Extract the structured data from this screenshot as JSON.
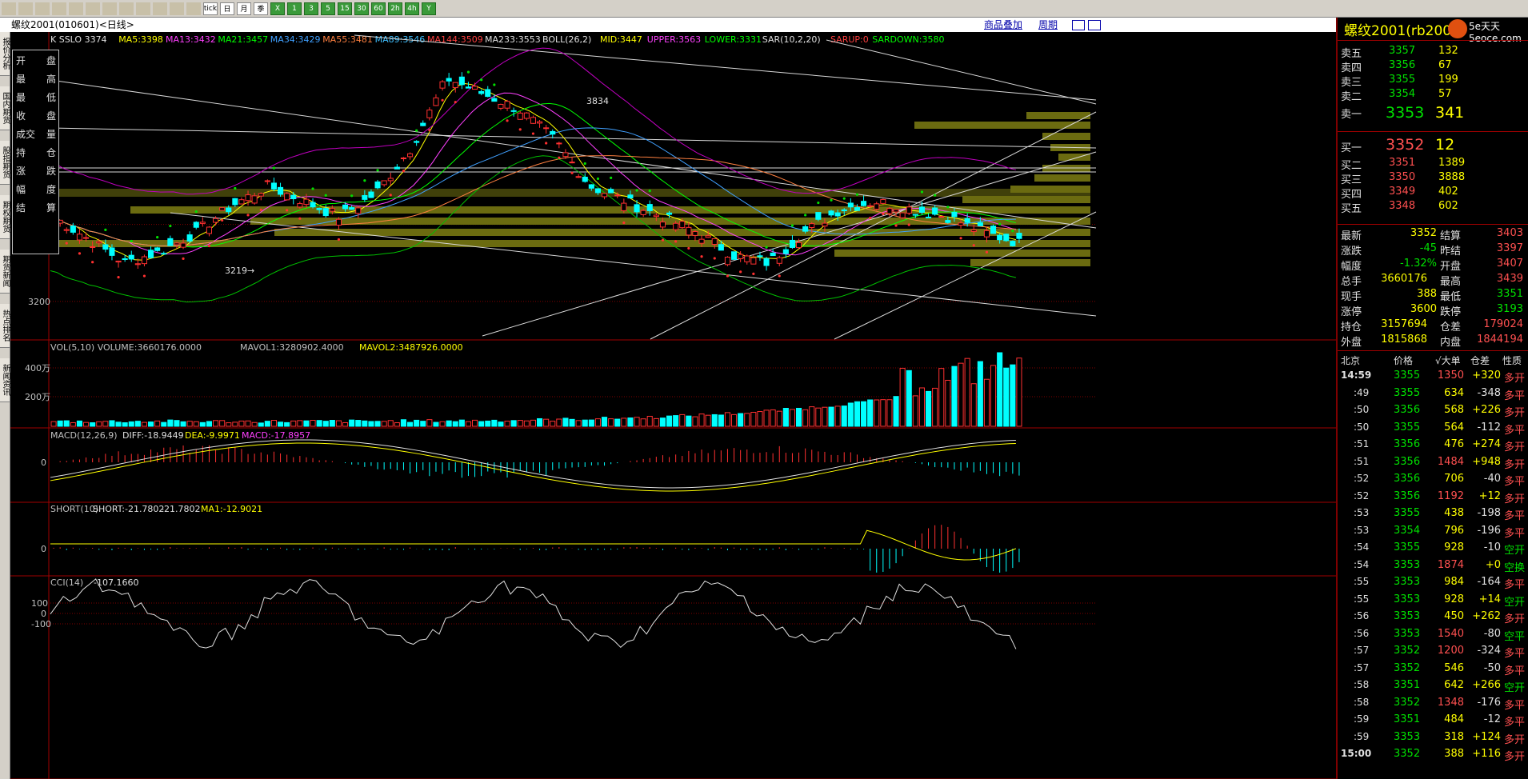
{
  "toolbar": {
    "icons": [
      "arrow-left-icon",
      "home-icon",
      "notebook-icon",
      "box-icon",
      "zoom-in-icon",
      "zoom-out-icon",
      "window-icon",
      "pencil-icon",
      "eraser-icon",
      "funnel-icon",
      "table-icon",
      "line-chart-icon",
      "tick-icon",
      "day-icon",
      "month-icon",
      "week-icon",
      "cross-icon",
      "1-min-icon",
      "3-min-icon",
      "5-min-icon",
      "15-min-icon",
      "30-min-icon",
      "60-min-icon",
      "2h-icon",
      "4h-icon",
      "year-icon"
    ],
    "labels": [
      "",
      "",
      "",
      "",
      "",
      "",
      "",
      "",
      "",
      "",
      "",
      "",
      "tick",
      "日",
      "月",
      "季",
      "X",
      "1",
      "3",
      "5",
      "15",
      "30",
      "60",
      "2h",
      "4h",
      "Y"
    ]
  },
  "titlebar": {
    "title": "螺纹2001(010601)<日线>",
    "link1": "商品叠加",
    "link2": "周期"
  },
  "left_tabs": [
    "报价分析",
    "国内期货",
    "股指期货",
    "期权期货",
    "期货新闻",
    "热点排名",
    "新闻资讯"
  ],
  "indicator_line": {
    "k": "K  SSLO 3374",
    "ma5": "MA5:3398",
    "ma13": "MA13:3432",
    "ma21": "MA21:3457",
    "ma34": "MA34:3429",
    "ma55": "MA55:3481",
    "ma89": "MA89:3546",
    "ma144": "MA144:3509",
    "ma233": "MA233:3553",
    "boll": "BOLL(26,2)",
    "mid": "MID:3447",
    "upper": "UPPER:3563",
    "lower": "LOWER:3331",
    "sar": "SAR(10,2,20)",
    "sarup": "SARUP:0",
    "sardown": "SARDOWN:3580"
  },
  "infobox": [
    {
      "a": "开",
      "b": "盘"
    },
    {
      "a": "最",
      "b": "高"
    },
    {
      "a": "最",
      "b": "低"
    },
    {
      "a": "收",
      "b": "盘"
    },
    {
      "a": "成交",
      "b": "量"
    },
    {
      "a": "持",
      "b": "仓"
    },
    {
      "a": "涨",
      "b": "跌"
    },
    {
      "a": "幅",
      "b": "度"
    },
    {
      "a": "结",
      "b": "算"
    }
  ],
  "price_axis": [
    "3400",
    "3200"
  ],
  "annotations": {
    "high": "3834",
    "low": "3219"
  },
  "vol": {
    "line1": "VOL(5,10) VOLUME:3660176.0000",
    "line2": "MAVOL1:3280902.4000",
    "line3": "MAVOL2:3487926.0000",
    "ticks": [
      "400万",
      "200万"
    ]
  },
  "macd": {
    "title": "MACD(12,26,9)",
    "diff": "DIFF:-18.9449",
    "dea": "DEA:-9.9971",
    "macd": "MACD:-17.8957",
    "zero": "0"
  },
  "short": {
    "title": "SHORT(10)",
    "s1": "SHORT:-21.7802",
    "s2": "-21.7802",
    "ma1": "MA1:-12.9021",
    "zero": "0"
  },
  "cci": {
    "title": "CCI(14)",
    "value": "-107.1660",
    "ticks": [
      "100",
      "0",
      "-100"
    ]
  },
  "right": {
    "title": "螺纹2001(rb2001)",
    "asks": [
      {
        "label": "卖五",
        "price": "3357",
        "vol": "132"
      },
      {
        "label": "卖四",
        "price": "3356",
        "vol": "67"
      },
      {
        "label": "卖三",
        "price": "3355",
        "vol": "199"
      },
      {
        "label": "卖二",
        "price": "3354",
        "vol": "57"
      },
      {
        "label": "卖一",
        "price": "3353",
        "vol": "341"
      }
    ],
    "bids": [
      {
        "label": "买一",
        "price": "3352",
        "vol": "12"
      },
      {
        "label": "买二",
        "price": "3351",
        "vol": "1389"
      },
      {
        "label": "买三",
        "price": "3350",
        "vol": "3888"
      },
      {
        "label": "买四",
        "price": "3349",
        "vol": "402"
      },
      {
        "label": "买五",
        "price": "3348",
        "vol": "602"
      }
    ],
    "stats": [
      {
        "l1": "最新",
        "v1": "3352",
        "l2": "结算",
        "v2": "3403"
      },
      {
        "l1": "涨跌",
        "v1": "-45",
        "l2": "昨结",
        "v2": "3397"
      },
      {
        "l1": "幅度",
        "v1": "-1.32%",
        "l2": "开盘",
        "v2": "3407"
      },
      {
        "l1": "总手",
        "v1": "3660176",
        "l2": "最高",
        "v2": "3439"
      },
      {
        "l1": "现手",
        "v1": "388",
        "l2": "最低",
        "v2": "3351"
      },
      {
        "l1": "涨停",
        "v1": "3600",
        "l2": "跌停",
        "v2": "3193"
      },
      {
        "l1": "持仓",
        "v1": "3157694",
        "l2": "仓差",
        "v2": "179024"
      },
      {
        "l1": "外盘",
        "v1": "1815868",
        "l2": "内盘",
        "v2": "1844194"
      }
    ],
    "tick_header": [
      "北京",
      "价格",
      "√大单",
      "仓差",
      "性质"
    ],
    "ticks": [
      {
        "t": "14:59",
        "p": "3355",
        "v": "1350",
        "d": "+320",
        "k": "多开"
      },
      {
        "t": ":49",
        "p": "3355",
        "v": "634",
        "d": "-348",
        "k": "多平"
      },
      {
        "t": ":50",
        "p": "3356",
        "v": "568",
        "d": "+226",
        "k": "多开"
      },
      {
        "t": ":50",
        "p": "3355",
        "v": "564",
        "d": "-112",
        "k": "多平"
      },
      {
        "t": ":51",
        "p": "3356",
        "v": "476",
        "d": "+274",
        "k": "多开"
      },
      {
        "t": ":51",
        "p": "3356",
        "v": "1484",
        "d": "+948",
        "k": "多开"
      },
      {
        "t": ":52",
        "p": "3356",
        "v": "706",
        "d": "-40",
        "k": "多平"
      },
      {
        "t": ":52",
        "p": "3356",
        "v": "1192",
        "d": "+12",
        "k": "多开"
      },
      {
        "t": ":53",
        "p": "3355",
        "v": "438",
        "d": "-198",
        "k": "多平"
      },
      {
        "t": ":53",
        "p": "3354",
        "v": "796",
        "d": "-196",
        "k": "多平"
      },
      {
        "t": ":54",
        "p": "3355",
        "v": "928",
        "d": "-10",
        "k": "空开"
      },
      {
        "t": ":54",
        "p": "3353",
        "v": "1874",
        "d": "+0",
        "k": "空换"
      },
      {
        "t": ":55",
        "p": "3353",
        "v": "984",
        "d": "-164",
        "k": "多平"
      },
      {
        "t": ":55",
        "p": "3353",
        "v": "928",
        "d": "+14",
        "k": "空开"
      },
      {
        "t": ":56",
        "p": "3353",
        "v": "450",
        "d": "+262",
        "k": "多开"
      },
      {
        "t": ":56",
        "p": "3353",
        "v": "1540",
        "d": "-80",
        "k": "空平"
      },
      {
        "t": ":57",
        "p": "3352",
        "v": "1200",
        "d": "-324",
        "k": "多平"
      },
      {
        "t": ":57",
        "p": "3352",
        "v": "546",
        "d": "-50",
        "k": "多平"
      },
      {
        "t": ":58",
        "p": "3351",
        "v": "642",
        "d": "+266",
        "k": "空开"
      },
      {
        "t": ":58",
        "p": "3352",
        "v": "1348",
        "d": "-176",
        "k": "多平"
      },
      {
        "t": ":59",
        "p": "3351",
        "v": "484",
        "d": "-12",
        "k": "多平"
      },
      {
        "t": ":59",
        "p": "3353",
        "v": "318",
        "d": "+124",
        "k": "多开"
      },
      {
        "t": "15:00",
        "p": "3352",
        "v": "388",
        "d": "+116",
        "k": "多开"
      }
    ]
  },
  "watermark": "5e天天 5eoce.com",
  "colors": {
    "up": "#ff3030",
    "down": "#00ffff",
    "sar": "#00e000",
    "volBar": "#808000",
    "boll": "#c000c0"
  }
}
